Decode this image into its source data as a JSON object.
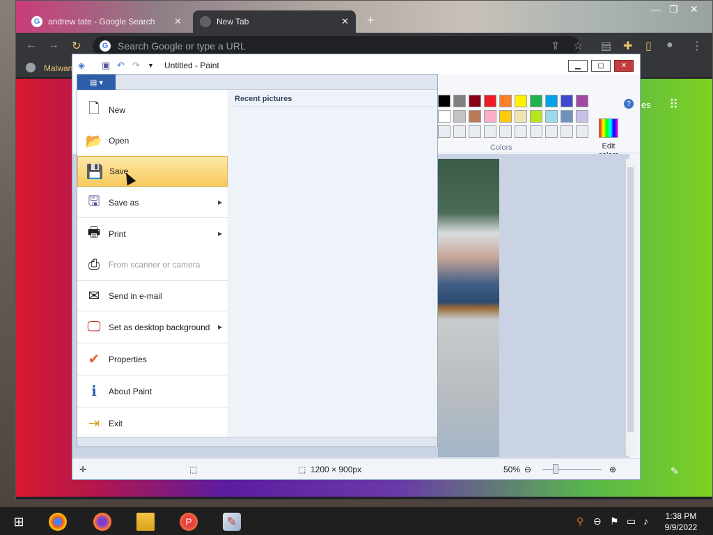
{
  "browser": {
    "tabs": [
      {
        "title": "andrew tate - Google Search",
        "active": false
      },
      {
        "title": "New Tab",
        "active": true
      }
    ],
    "omnibox_placeholder": "Search Google or type a URL",
    "bookmark": "Malwan",
    "page_label_partial": "es"
  },
  "paint": {
    "title": "Untitled - Paint",
    "menu_button": "File",
    "colors_label": "Colors",
    "edit_colors_line1": "Edit",
    "edit_colors_line2": "colors",
    "palette_row1": [
      "#000000",
      "#7f7f7f",
      "#880015",
      "#ed1c24",
      "#ff7f27",
      "#fff200",
      "#22b14c",
      "#00a2e8",
      "#3f48cc",
      "#a349a4"
    ],
    "palette_row2": [
      "#ffffff",
      "#c3c3c3",
      "#b97a57",
      "#ffaec9",
      "#ffc90e",
      "#efe4b0",
      "#b5e61d",
      "#99d9ea",
      "#7092be",
      "#c8bfe7"
    ],
    "palette_row3": [
      "#e8edf3",
      "#e8edf3",
      "#e8edf3",
      "#e8edf3",
      "#e8edf3",
      "#e8edf3",
      "#e8edf3",
      "#e8edf3",
      "#e8edf3",
      "#e8edf3"
    ],
    "file_menu": {
      "items": [
        {
          "label": "New",
          "icon": "new-file-icon",
          "submenu": false,
          "disabled": false,
          "hover": false
        },
        {
          "label": "Open",
          "icon": "folder-open-icon",
          "submenu": false,
          "disabled": false,
          "hover": false
        },
        {
          "label": "Save",
          "icon": "floppy-disk-icon",
          "submenu": false,
          "disabled": false,
          "hover": true
        },
        {
          "label": "Save as",
          "icon": "save-as-icon",
          "submenu": true,
          "disabled": false,
          "hover": false
        },
        {
          "label": "Print",
          "icon": "printer-icon",
          "submenu": true,
          "disabled": false,
          "hover": false
        },
        {
          "label": "From scanner or camera",
          "icon": "scanner-icon",
          "submenu": false,
          "disabled": true,
          "hover": false
        },
        {
          "label": "Send in e-mail",
          "icon": "email-icon",
          "submenu": false,
          "disabled": false,
          "hover": false
        },
        {
          "label": "Set as desktop background",
          "icon": "desktop-background-icon",
          "submenu": true,
          "disabled": false,
          "hover": false
        },
        {
          "label": "Properties",
          "icon": "checkmark-icon",
          "submenu": false,
          "disabled": false,
          "hover": false
        },
        {
          "label": "About Paint",
          "icon": "info-icon",
          "submenu": false,
          "disabled": false,
          "hover": false
        },
        {
          "label": "Exit",
          "icon": "exit-icon",
          "submenu": false,
          "disabled": false,
          "hover": false
        }
      ],
      "recent_title": "Recent pictures"
    },
    "status": {
      "dimensions": "1200 × 900px",
      "zoom": "50%"
    }
  },
  "taskbar": {
    "time": "1:38 PM",
    "date": "9/9/2022"
  }
}
